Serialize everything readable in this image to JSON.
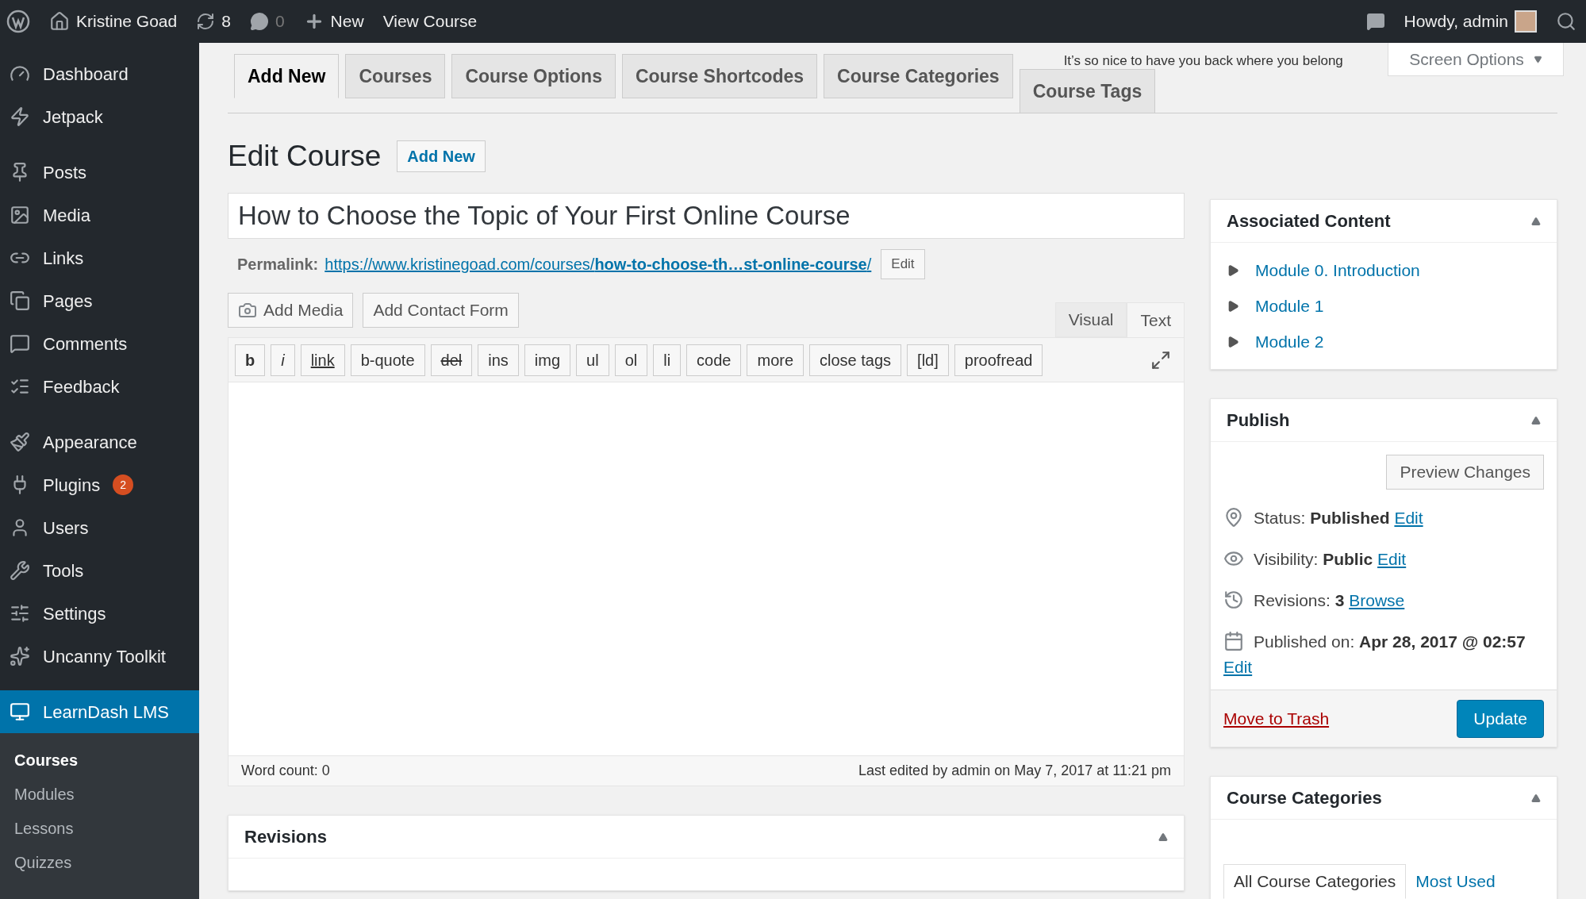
{
  "admin_bar": {
    "site_name": "Kristine Goad",
    "updates_count": "8",
    "comments_count": "0",
    "new_label": "New",
    "view_label": "View Course",
    "greeting": "Howdy, admin"
  },
  "sidebar": {
    "groups": [
      [
        {
          "label": "Dashboard",
          "selected": false
        },
        {
          "label": "Jetpack",
          "selected": false
        }
      ],
      [
        {
          "label": "Posts",
          "selected": false
        },
        {
          "label": "Media",
          "selected": false
        },
        {
          "label": "Links",
          "selected": false
        },
        {
          "label": "Pages",
          "selected": false
        },
        {
          "label": "Comments",
          "selected": false
        },
        {
          "label": "Feedback",
          "selected": false
        }
      ],
      [
        {
          "label": "Appearance",
          "selected": false
        },
        {
          "label": "Plugins",
          "selected": false,
          "badge": "2"
        },
        {
          "label": "Users",
          "selected": false
        },
        {
          "label": "Tools",
          "selected": false
        },
        {
          "label": "Settings",
          "selected": false
        },
        {
          "label": "Uncanny Toolkit",
          "selected": false
        }
      ],
      [
        {
          "label": "LearnDash LMS",
          "selected": true
        }
      ]
    ],
    "submenu": [
      {
        "label": "Courses",
        "selected": true
      },
      {
        "label": "Modules",
        "selected": false
      },
      {
        "label": "Lessons",
        "selected": false
      },
      {
        "label": "Quizzes",
        "selected": false
      }
    ]
  },
  "tabs": [
    {
      "label": "Add New",
      "selected": true
    },
    {
      "label": "Courses",
      "selected": false
    },
    {
      "label": "Course Options",
      "selected": false
    },
    {
      "label": "Course Shortcodes",
      "selected": false
    },
    {
      "label": "Course Categories",
      "selected": false
    },
    {
      "label": "Course Tags",
      "selected": false
    }
  ],
  "notice": "It’s so nice to have you back where you belong",
  "screen_options": "Screen Options",
  "heading": "Edit Course",
  "add_new": "Add New",
  "title_value": "How to Choose the Topic of Your First Online Course",
  "permalink": {
    "label": "Permalink:",
    "url": "https://www.kristinegoad.com/courses/**how-to-choose-th…st-online-course**/",
    "edit": "Edit"
  },
  "media_buttons": [
    {
      "kind": "media",
      "label": "Add Media"
    },
    {
      "kind": "plain",
      "label": "Add Contact Form"
    }
  ],
  "editor_tabs": [
    {
      "label": "Visual",
      "selected": false
    },
    {
      "label": "Text",
      "selected": true
    }
  ],
  "quicktags": [
    {
      "label": "b",
      "kind": "bold"
    },
    {
      "label": "i",
      "kind": "italic"
    },
    {
      "label": "link",
      "kind": "underline"
    },
    {
      "label": "b-quote",
      "kind": "plain"
    },
    {
      "label": "del",
      "kind": "strike"
    },
    {
      "label": "ins",
      "kind": "plain"
    },
    {
      "label": "img",
      "kind": "plain"
    },
    {
      "label": "ul",
      "kind": "plain"
    },
    {
      "label": "ol",
      "kind": "plain"
    },
    {
      "label": "li",
      "kind": "plain"
    },
    {
      "label": "code",
      "kind": "plain"
    },
    {
      "label": "more",
      "kind": "plain"
    },
    {
      "label": "close tags",
      "kind": "plain"
    },
    {
      "label": "[ld]",
      "kind": "plain"
    },
    {
      "label": "proofread",
      "kind": "plain"
    }
  ],
  "word_count": "Word count: 0",
  "last_edited": "Last edited by admin on May 7, 2017 at 11:21 pm",
  "revisions_box": {
    "title": "Revisions"
  },
  "associated": {
    "title": "Associated Content",
    "items": [
      {
        "label": "Module 0. Introduction",
        "expanded": false
      },
      {
        "label": "Module 1",
        "expanded": false
      },
      {
        "label": "Module 2",
        "expanded": false
      }
    ]
  },
  "publish": {
    "title": "Publish",
    "preview": "Preview Changes",
    "rows": [
      {
        "kind": "status",
        "label": "Status:",
        "value": "Published",
        "link": "Edit"
      },
      {
        "kind": "visibility",
        "label": "Visibility:",
        "value": "Public",
        "link": "Edit"
      },
      {
        "kind": "revisions",
        "label": "Revisions:",
        "value": "3",
        "link": "Browse"
      },
      {
        "kind": "date",
        "label": "Published on:",
        "value": "Apr 28, 2017 @ 02:57",
        "link": "Edit"
      }
    ],
    "trash": "Move to Trash",
    "update": "Update"
  },
  "categories": {
    "title": "Course Categories",
    "tabs": [
      {
        "label": "All Course Categories",
        "selected": true
      },
      {
        "label": "Most Used",
        "selected": false
      }
    ]
  }
}
